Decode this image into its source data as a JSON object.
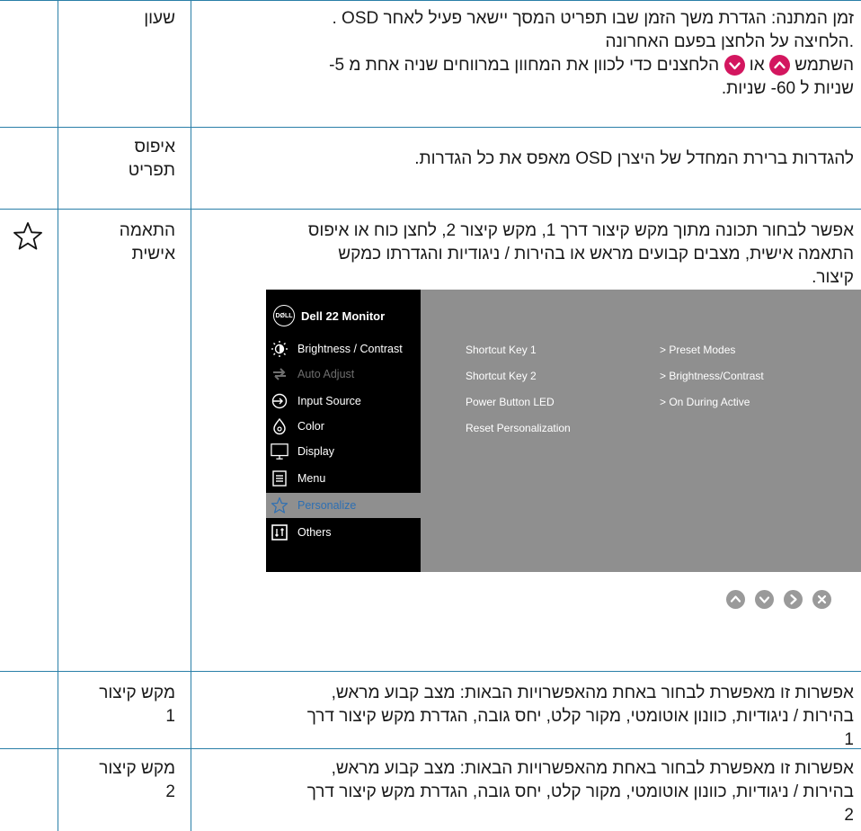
{
  "rows": [
    {
      "label": "שעון",
      "lines": [
        "זמן המתנה: הגדרת משך הזמן שבו תפריט המסך יישאר פעיל לאחר OSD .",
        ".הלחיצה על הלחצן בפעם האחרונה",
        "השתמש __UP__ או __DOWN__ הלחצנים כדי לכוון את המחוון במרווחים שניה אחת מ 5-",
        "שניות ל 60- שניות."
      ],
      "inline_parts": {
        "before": "השתמש",
        "mid": "או",
        "after": "הלחצנים כדי לכוון את המחוון במרווחים שניה אחת מ 5-"
      }
    },
    {
      "label_lines": [
        "איפוס",
        "תפריט"
      ],
      "lines": [
        "להגדרות ברירת המחדל של היצרן OSD מאפס את כל הגדרות."
      ]
    },
    {
      "label_lines": [
        "התאמה",
        "אישית"
      ],
      "icon": "star-icon",
      "lines": [
        "אפשר לבחור תכונה מתוך מקש קיצור דרך 1, מקש קיצור 2, לחצן כוח או איפוס",
        "התאמה אישית, מצבים קבועים מראש או בהירות / ניגודיות והגדרתו כמקש",
        "קיצור."
      ]
    },
    {
      "label_lines": [
        "מקש קיצור",
        "1"
      ],
      "lines": [
        "אפשרות זו מאפשרת לבחור באחת מהאפשרויות הבאות: מצב קבוע מראש,",
        "בהירות / ניגודיות, כוונון אוטומטי, מקור קלט, יחס גובה, הגדרת מקש קיצור דרך",
        "1"
      ]
    },
    {
      "label_lines": [
        "מקש קיצור",
        "2"
      ],
      "lines": [
        "אפשרות זו מאפשרת לבחור באחת מהאפשרויות הבאות: מצב קבוע מראש,",
        "בהירות / ניגודיות, כוונון אוטומטי, מקור קלט, יחס גובה, הגדרת מקש קיצור דרך",
        "2"
      ]
    }
  ],
  "osd": {
    "logo": "DØLL",
    "title": "Dell 22 Monitor",
    "menu": [
      {
        "label": "Brightness / Contrast",
        "icon": "brightness-icon"
      },
      {
        "label": "Auto Adjust",
        "icon": "auto-adjust-icon"
      },
      {
        "label": "Input Source",
        "icon": "input-source-icon"
      },
      {
        "label": "Color",
        "icon": "color-icon"
      },
      {
        "label": "Display",
        "icon": "display-icon"
      },
      {
        "label": "Menu",
        "icon": "menu-icon"
      },
      {
        "label": "Personalize",
        "icon": "star-icon"
      },
      {
        "label": "Others",
        "icon": "others-icon"
      }
    ],
    "submenu": [
      {
        "label": "Shortcut Key 1",
        "value": "Preset Modes"
      },
      {
        "label": "Shortcut Key 2",
        "value": "Brightness/Contrast"
      },
      {
        "label": "Power Button LED",
        "value": "On During Active"
      },
      {
        "label": "Reset Personalization",
        "value": ""
      }
    ],
    "buttons": [
      "up-icon",
      "down-icon",
      "right-icon",
      "close-icon"
    ]
  }
}
